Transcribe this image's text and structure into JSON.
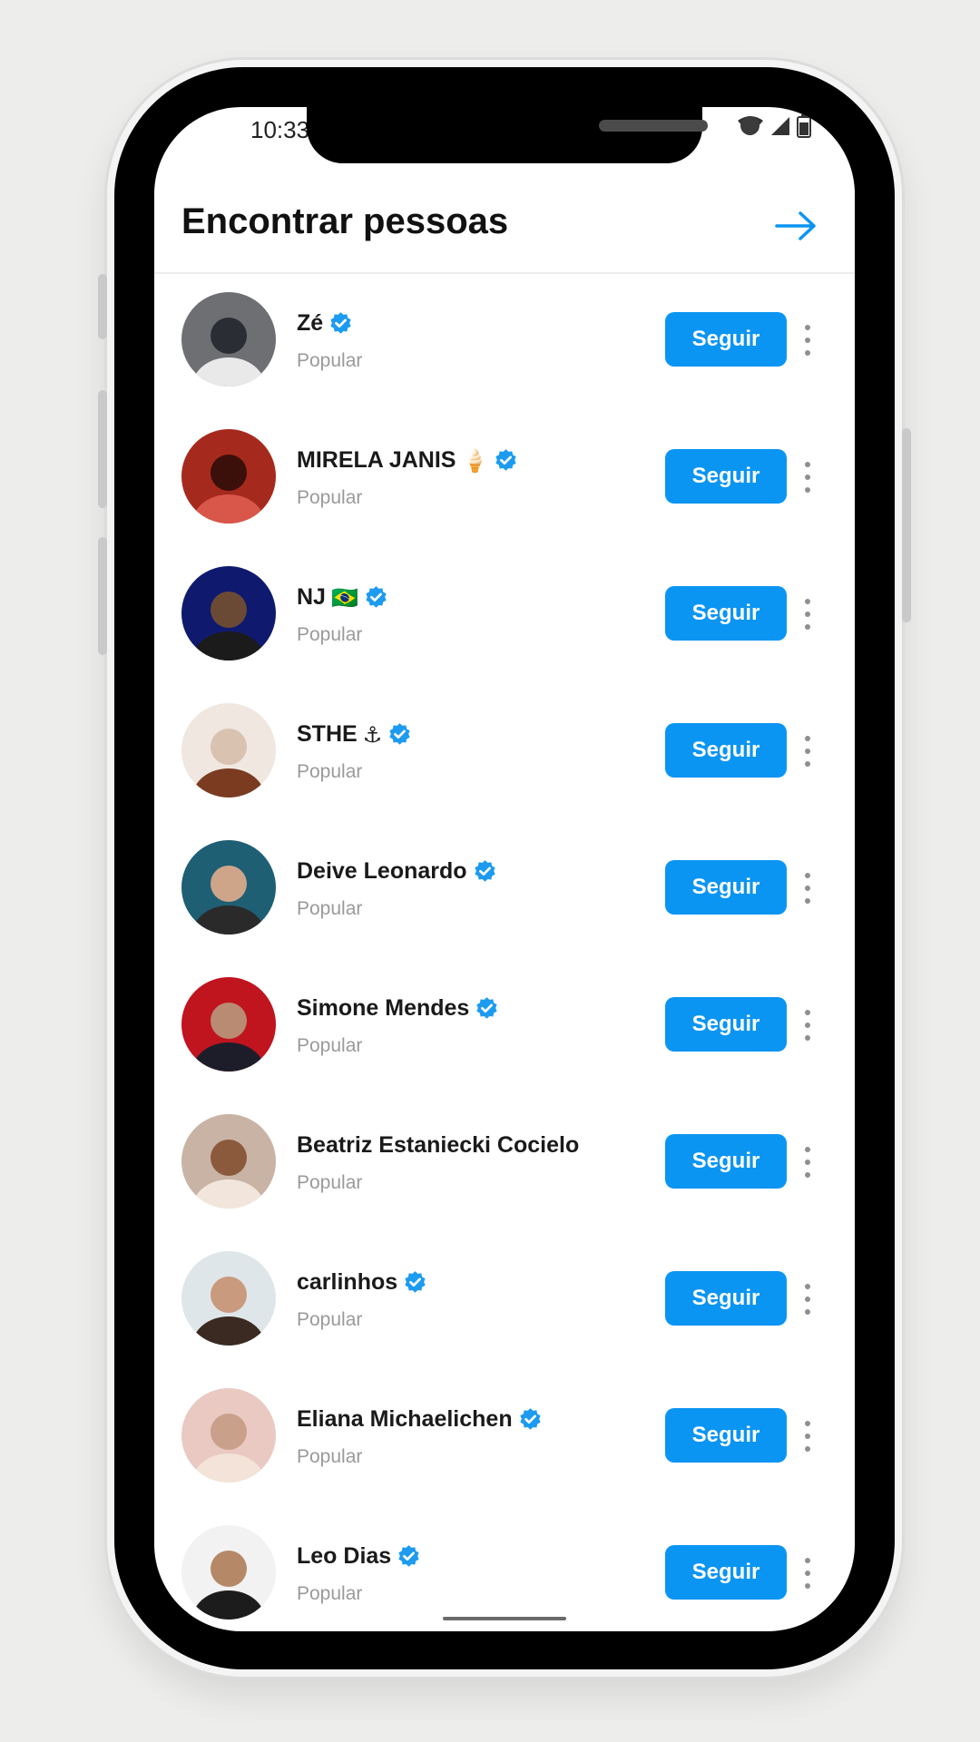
{
  "status_bar": {
    "time": "10:33"
  },
  "header": {
    "title": "Encontrar pessoas",
    "next_icon": "arrow-right-icon"
  },
  "colors": {
    "accent": "#0b95f2",
    "verified": "#1d9bf0",
    "subtitle": "#9a9a9a"
  },
  "people": [
    {
      "name": "Zé",
      "emoji": "",
      "verified": true,
      "subtitle": "Popular",
      "button": "Seguir"
    },
    {
      "name": "MIRELA JANIS",
      "emoji": "🍦",
      "verified": true,
      "subtitle": "Popular",
      "button": "Seguir"
    },
    {
      "name": "NJ",
      "emoji": "🇧🇷",
      "verified": true,
      "subtitle": "Popular",
      "button": "Seguir"
    },
    {
      "name": "STHE",
      "emoji": "⚓",
      "verified": true,
      "subtitle": "Popular",
      "button": "Seguir"
    },
    {
      "name": "Deive Leonardo",
      "emoji": "",
      "verified": true,
      "subtitle": "Popular",
      "button": "Seguir"
    },
    {
      "name": "Simone Mendes",
      "emoji": "",
      "verified": true,
      "subtitle": "Popular",
      "button": "Seguir"
    },
    {
      "name": "Beatriz Estaniecki Cocielo",
      "emoji": "",
      "verified": false,
      "subtitle": "Popular",
      "button": "Seguir"
    },
    {
      "name": "carlinhos",
      "emoji": "",
      "verified": true,
      "subtitle": "Popular",
      "button": "Seguir"
    },
    {
      "name": "Eliana Michaelichen",
      "emoji": "",
      "verified": true,
      "subtitle": "Popular",
      "button": "Seguir"
    },
    {
      "name": "Leo Dias",
      "emoji": "",
      "verified": true,
      "subtitle": "Popular",
      "button": "Seguir"
    }
  ]
}
